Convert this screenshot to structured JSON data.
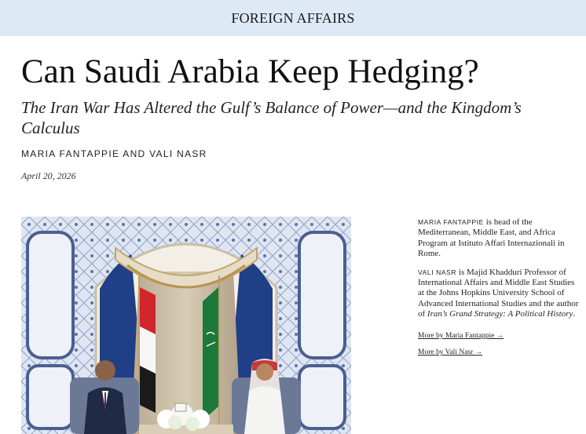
{
  "header": {
    "brand": "FOREIGN AFFAIRS",
    "background": "#dde9f5"
  },
  "article": {
    "title": "Can Saudi Arabia Keep Hedging?",
    "subtitle": "The Iran War Has Altered the Gulf’s Balance of Power—and the Kingdom’s Calculus",
    "byline": "MARIA FANTAPPIE AND VALI NASR",
    "date": "April 20, 2026",
    "image_icon": "photo-summit-meeting"
  },
  "sidebar": {
    "authors": [
      {
        "name": "MARIA FANTAPPIE",
        "bio": " is head of the Mediterranean, Middle East, and Africa Program at Istituto Affari Internazionali in Rome."
      },
      {
        "name": "VALI NASR",
        "bio_before": " is Majid Khadduri Professor of International Affairs and Middle East Studies at the Johns Hopkins University School of Advanced International Studies and the author of ",
        "book": "Iran’s Grand Strategy: A Political History",
        "bio_after": "."
      }
    ],
    "links": [
      {
        "label": "More by Maria Fantappie →"
      },
      {
        "label": "More by Vali Nasr →"
      }
    ]
  }
}
